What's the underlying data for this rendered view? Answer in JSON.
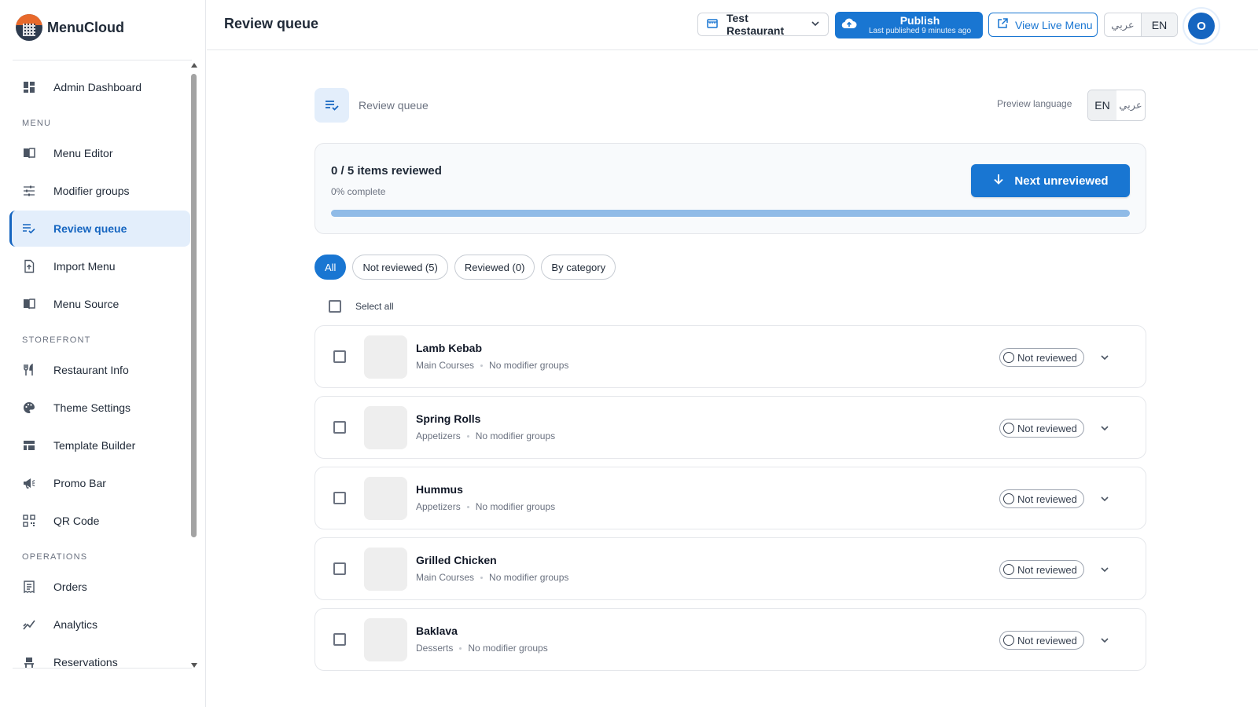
{
  "brand": {
    "name": "MenuCloud"
  },
  "sidebar": {
    "top_items": [
      {
        "label": "Admin Dashboard",
        "icon": "dashboard-icon"
      }
    ],
    "sections": [
      {
        "label": "MENU",
        "items": [
          {
            "label": "Menu Editor",
            "icon": "book-icon"
          },
          {
            "label": "Modifier groups",
            "icon": "sliders-icon"
          },
          {
            "label": "Review queue",
            "icon": "checklist-icon",
            "active": true
          },
          {
            "label": "Import Menu",
            "icon": "file-import-icon"
          },
          {
            "label": "Menu Source",
            "icon": "book-icon"
          }
        ]
      },
      {
        "label": "STOREFRONT",
        "items": [
          {
            "label": "Restaurant Info",
            "icon": "fork-knife-icon"
          },
          {
            "label": "Theme Settings",
            "icon": "palette-icon"
          },
          {
            "label": "Template Builder",
            "icon": "grid-icon"
          },
          {
            "label": "Promo Bar",
            "icon": "megaphone-icon"
          },
          {
            "label": "QR Code",
            "icon": "qr-code-icon"
          }
        ]
      },
      {
        "label": "OPERATIONS",
        "items": [
          {
            "label": "Orders",
            "icon": "receipt-icon"
          },
          {
            "label": "Analytics",
            "icon": "chart-line-icon"
          },
          {
            "label": "Reservations",
            "icon": "table-chair-icon"
          }
        ]
      }
    ]
  },
  "header": {
    "title": "Review queue",
    "restaurant": "Test Restaurant",
    "publish": {
      "label": "Publish",
      "sub": "Last published 9 minutes ago"
    },
    "view_live": "View Live Menu",
    "lang_ar": "عربي",
    "lang_en": "EN",
    "avatar_initial": "O"
  },
  "page": {
    "title": "Review queue",
    "preview_label": "Preview language",
    "preview_en": "EN",
    "preview_ar": "عربي"
  },
  "progress": {
    "title": "0 / 5 items reviewed",
    "subtitle": "0% complete",
    "fraction": 0,
    "next_label": "Next unreviewed"
  },
  "filters": [
    {
      "label": "All",
      "active": true
    },
    {
      "label": "Not reviewed (5)"
    },
    {
      "label": "Reviewed (0)"
    },
    {
      "label": "By category"
    }
  ],
  "select_all": "Select all",
  "items": [
    {
      "name": "Lamb Kebab",
      "category": "Main Courses",
      "modifiers": "No modifier groups",
      "status": "Not reviewed"
    },
    {
      "name": "Spring Rolls",
      "category": "Appetizers",
      "modifiers": "No modifier groups",
      "status": "Not reviewed"
    },
    {
      "name": "Hummus",
      "category": "Appetizers",
      "modifiers": "No modifier groups",
      "status": "Not reviewed"
    },
    {
      "name": "Grilled Chicken",
      "category": "Main Courses",
      "modifiers": "No modifier groups",
      "status": "Not reviewed"
    },
    {
      "name": "Baklava",
      "category": "Desserts",
      "modifiers": "No modifier groups",
      "status": "Not reviewed"
    }
  ],
  "colors": {
    "primary": "#1976d2",
    "active_bg": "#e3eefb",
    "progress_track": "#90bbe7"
  }
}
